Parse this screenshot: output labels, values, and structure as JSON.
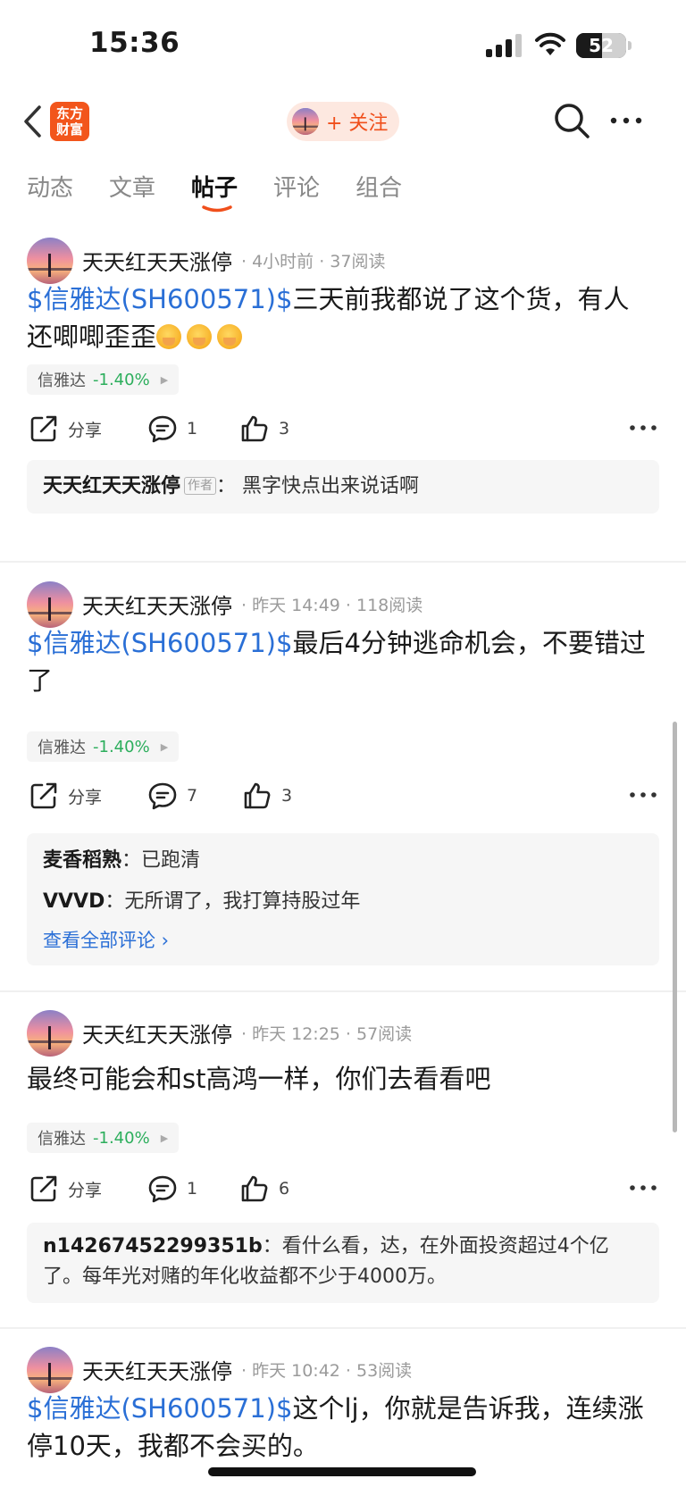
{
  "status_bar": {
    "time": "15:36",
    "battery": "52",
    "battery_level": 0.52
  },
  "nav": {
    "logo_text": "东方\n财富",
    "follow_label": "+ 关注"
  },
  "tabs": [
    "动态",
    "文章",
    "帖子",
    "评论",
    "组合"
  ],
  "active_tab": "帖子",
  "actions": {
    "share": "分享"
  },
  "posts": [
    {
      "author": "天天红天天涨停",
      "time": "· 4小时前 · 37阅读",
      "stock_link": "$信雅达(SH600571)$",
      "text": "三天前我都说了这个货，有人还唧唧歪歪",
      "emoji_count": 3,
      "stock_tag": {
        "name": "信雅达",
        "change": "-1.40%"
      },
      "comments_count": "1",
      "likes_count": "3",
      "comments": [
        {
          "author": "天天红天天涨停",
          "badge": "作者",
          "text": "：  黑字快点出来说话啊"
        }
      ]
    },
    {
      "author": "天天红天天涨停",
      "time": "· 昨天 14:49 · 118阅读",
      "stock_link": "$信雅达(SH600571)$",
      "text": "最后4分钟逃命机会，不要错过了",
      "stock_tag": {
        "name": "信雅达",
        "change": "-1.40%"
      },
      "comments_count": "7",
      "likes_count": "3",
      "comments": [
        {
          "author": "麦香稻熟",
          "text": "：已跑清"
        },
        {
          "author": "VVVD",
          "text": "：无所谓了，我打算持股过年"
        }
      ],
      "view_all": "查看全部评论 ›"
    },
    {
      "author": "天天红天天涨停",
      "time": "· 昨天 12:25 · 57阅读",
      "stock_link": "",
      "text": "最终可能会和st高鸿一样，你们去看看吧",
      "stock_tag": {
        "name": "信雅达",
        "change": "-1.40%"
      },
      "comments_count": "1",
      "likes_count": "6",
      "comments": [
        {
          "author": "n14267452299351b",
          "text": "：看什么看，达，在外面投资超过4个亿了。每年光对赌的年化收益都不少于4000万。"
        }
      ]
    },
    {
      "author": "天天红天天涨停",
      "time": "· 昨天 10:42 · 53阅读",
      "stock_link": "$信雅达(SH600571)$",
      "text": "这个lj，你就是告诉我，连续涨停10天，我都不会买的。"
    }
  ],
  "colors": {
    "accent_orange": "#f04f1b",
    "link_blue": "#2a6fd6",
    "down_green": "#2cae5c"
  }
}
